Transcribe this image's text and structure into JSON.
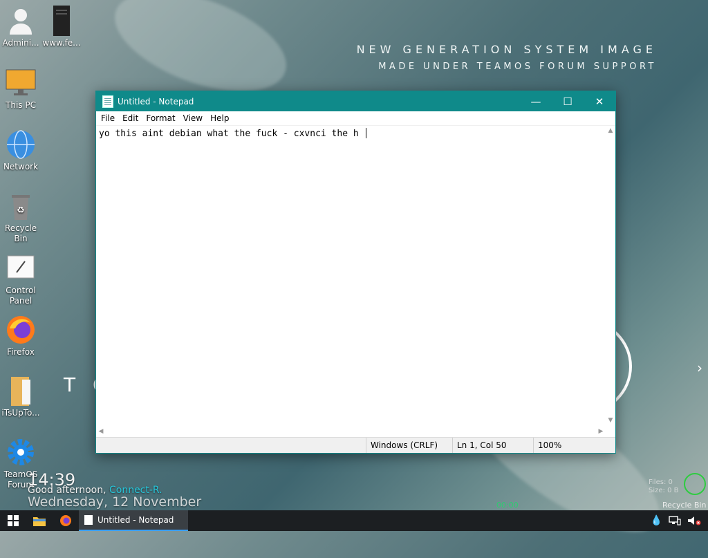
{
  "desktop": {
    "watermark_line1": "NEW GENERATION SYSTEM IMAGE",
    "watermark_line2": "MADE UNDER TEAMOS FORUM SUPPORT",
    "icons": [
      {
        "label": "Admini...",
        "icon": "user-icon"
      },
      {
        "label": "www.fe...",
        "icon": "file-icon"
      },
      {
        "label": "This PC",
        "icon": "monitor-icon"
      },
      {
        "label": "Network",
        "icon": "globe-icon"
      },
      {
        "label": "Recycle Bin",
        "icon": "recycle-bin-icon"
      },
      {
        "label": "Control Panel",
        "icon": "control-panel-icon"
      },
      {
        "label": "Firefox",
        "icon": "firefox-icon"
      },
      {
        "label": "iTsUpTo...",
        "icon": "folder-icon"
      },
      {
        "label": "TeamOS Forum",
        "icon": "gear-icon"
      }
    ]
  },
  "widgets": {
    "clock": "14:39",
    "greeting_prefix": "Good afternoon,",
    "greeting_user": "Connect-R.",
    "date": "Wednesday, 12 November",
    "decor_text": "T C",
    "files_line1": "Files: 0",
    "files_line2": "Size: 0 B",
    "recycle_label": "Recycle Bin",
    "timer": "00:00"
  },
  "notepad": {
    "title": "Untitled - Notepad",
    "menu": [
      "File",
      "Edit",
      "Format",
      "View",
      "Help"
    ],
    "content": "yo this aint debian what the fuck - cxvnci the h ",
    "status_line_ending": "Windows (CRLF)",
    "status_position": "Ln 1, Col 50",
    "status_zoom": "100%"
  },
  "taskbar": {
    "active_app": "Untitled - Notepad"
  },
  "colors": {
    "titlebar": "#0f8a8a",
    "taskbar": "#1c1f22",
    "accent": "#26c6da"
  }
}
